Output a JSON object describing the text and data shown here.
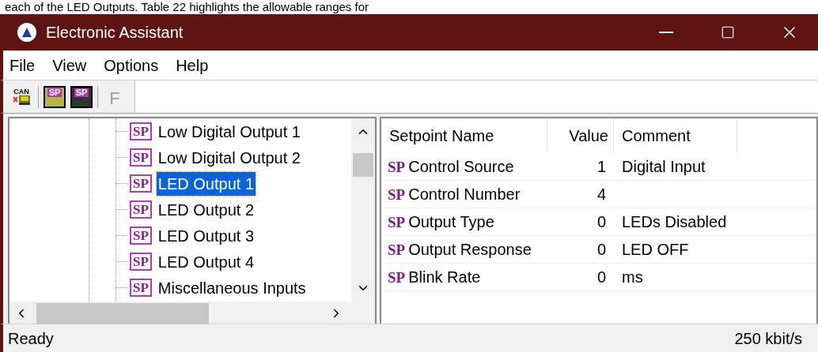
{
  "caption": "each of the LED Outputs. Table 22 highlights the allowable ranges for",
  "window": {
    "title": "Electronic Assistant"
  },
  "menu": [
    "File",
    "View",
    "Options",
    "Help"
  ],
  "toolbar": [
    {
      "kind": "can",
      "label": "CAN",
      "disabled": false
    },
    {
      "kind": "sp-open",
      "label": "SP",
      "disabled": false
    },
    {
      "kind": "sp-save",
      "label": "SP",
      "disabled": false
    },
    {
      "kind": "letter",
      "label": "F",
      "disabled": true
    }
  ],
  "tree": [
    {
      "label": "Low Digital Output 1",
      "badge": "SP",
      "selected": false
    },
    {
      "label": "Low Digital Output 2",
      "badge": "SP",
      "selected": false
    },
    {
      "label": "LED Output 1",
      "badge": "SP",
      "selected": true
    },
    {
      "label": "LED Output 2",
      "badge": "SP",
      "selected": false
    },
    {
      "label": "LED Output 3",
      "badge": "SP",
      "selected": false
    },
    {
      "label": "LED Output 4",
      "badge": "SP",
      "selected": false
    },
    {
      "label": "Miscellaneous Inputs",
      "badge": "SP",
      "selected": false
    }
  ],
  "table": {
    "columns": [
      "Setpoint Name",
      "Value",
      "Comment"
    ],
    "rows": [
      {
        "badge": "SP",
        "name": "Control Source",
        "value": "1",
        "comment": "Digital Input"
      },
      {
        "badge": "SP",
        "name": "Control Number",
        "value": "4",
        "comment": ""
      },
      {
        "badge": "SP",
        "name": "Output Type",
        "value": "0",
        "comment": "LEDs Disabled"
      },
      {
        "badge": "SP",
        "name": "Output Response",
        "value": "0",
        "comment": "LED OFF"
      },
      {
        "badge": "SP",
        "name": "Blink Rate",
        "value": "0",
        "comment": "ms"
      }
    ]
  },
  "status_bar": {
    "left": "Ready",
    "right": "250 kbit/s"
  }
}
